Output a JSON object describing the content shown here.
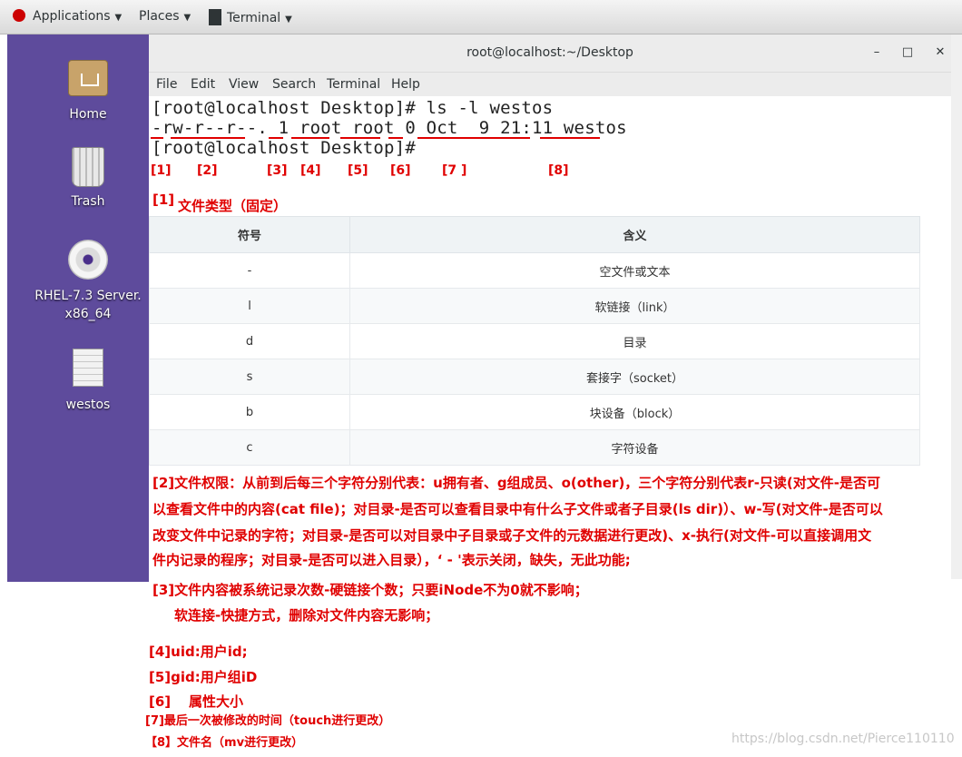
{
  "top_panel": {
    "applications": "Applications",
    "places": "Places",
    "terminal": "Terminal"
  },
  "desktop": {
    "icons": [
      {
        "label": "Home"
      },
      {
        "label": "Trash"
      },
      {
        "label_line1": "RHEL-7.3 Server.",
        "label_line2": "x86_64"
      },
      {
        "label": "westos"
      }
    ]
  },
  "window": {
    "title": "root@localhost:~/Desktop",
    "buttons": {
      "minimize": "–",
      "maximize": "□",
      "close": "✕"
    },
    "menu": [
      "File",
      "Edit",
      "View",
      "Search",
      "Terminal",
      "Help"
    ]
  },
  "terminal": {
    "line1": "[root@localhost Desktop]# ls -l westos",
    "line2": "-rw-r--r--. 1 root root 0 Oct  9 21:11 westos",
    "line3": "[root@localhost Desktop]#"
  },
  "annotations": {
    "labels": [
      "[1]",
      "[2]",
      "[3]",
      "[4]",
      "[5]",
      "[6]",
      "[7 ]",
      "[8]"
    ],
    "section1_num": "[1]",
    "section1_title": "文件类型（固定）"
  },
  "file_type_table": {
    "headers": [
      "符号",
      "含义"
    ],
    "rows": [
      [
        "-",
        "空文件或文本"
      ],
      [
        "l",
        "软链接（link）"
      ],
      [
        "d",
        "目录"
      ],
      [
        "s",
        "套接字（socket）"
      ],
      [
        "b",
        "块设备（block）"
      ],
      [
        "c",
        "字符设备"
      ]
    ]
  },
  "notes": {
    "n2_l1": "[2]文件权限：从前到后每三个字符分别代表：u拥有者、g组成员、o(other)，三个字符分别代表r-只读(对文件-是否可",
    "n2_l2": "以查看文件中的内容(cat file)；对目录-是否可以查看目录中有什么子文件或者子目录(ls dir)）、w-写(对文件-是否可以",
    "n2_l3": "改变文件中记录的字符；对目录-是否可以对目录中子目录或子文件的元数据进行更改)、x-执行(对文件-可以直接调用文",
    "n2_l4": "件内记录的程序；对目录-是否可以进入目录），‘ - '表示关闭，缺失，无此功能;",
    "n3_l1": "[3]文件内容被系统记录次数-硬链接个数；只要iNode不为0就不影响；",
    "n3_l2": "软连接-快捷方式，删除对文件内容无影响；",
    "n4": "[4]uid:用户id;",
    "n5": "[5]gid:用户组iD",
    "n6_num": "[6]",
    "n6_text": "属性大小",
    "n7": "[7]最后一次被修改的时间（touch进行更改）",
    "n8": "【8】文件名（mv进行更改）"
  },
  "watermark": "https://blog.csdn.net/Pierce110110"
}
